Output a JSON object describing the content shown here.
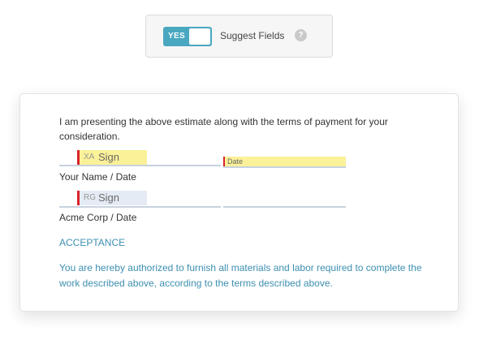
{
  "toolbar": {
    "toggle_state": "YES",
    "suggest_label": "Suggest Fields",
    "help_glyph": "?"
  },
  "document": {
    "intro": "I am presenting the above estimate along with the terms of payment for your consideration.",
    "signers": [
      {
        "initials": "XA",
        "sign_label": "Sign",
        "field_color": "#fbf198",
        "date_label": "Date",
        "caption": "Your Name / Date"
      },
      {
        "initials": "RG",
        "sign_label": "Sign",
        "field_color": "#e5ebf4",
        "caption": "Acme Corp / Date"
      }
    ],
    "acceptance_heading": "ACCEPTANCE",
    "acceptance_text": "You are hereby authorized to furnish all materials and labor required to complete the work described above, according to the terms described above."
  },
  "colors": {
    "toggle_on": "#4aa7c0",
    "required_marker": "#d9222a",
    "link_text": "#3d8fb0"
  }
}
